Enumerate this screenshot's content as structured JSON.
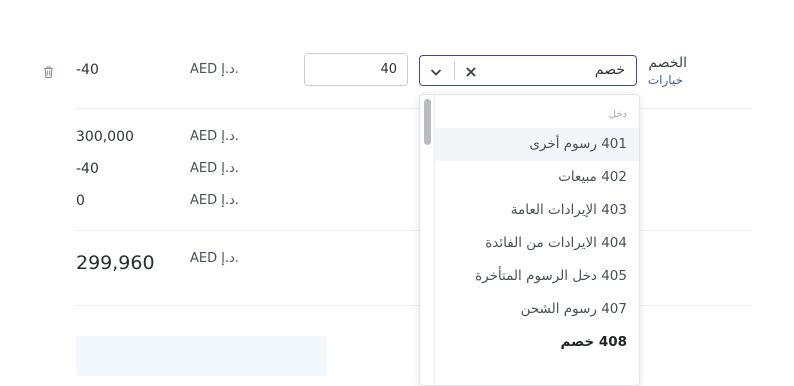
{
  "line_item": {
    "amount": "-40",
    "currency": "AED د.إ.",
    "quantity": "40",
    "account_value": "خصم",
    "label": "الخصم",
    "options_link": "خيارات"
  },
  "dropdown": {
    "group_label": "دخل",
    "options": [
      {
        "label": "401 رسوم أخرى"
      },
      {
        "label": "402 مبيعات"
      },
      {
        "label": "403 الإيرادات العامة"
      },
      {
        "label": "404 الايرادات من الفائدة"
      },
      {
        "label": "405 دخل الرسوم المتأخرة"
      },
      {
        "label": "407 رسوم الشحن"
      },
      {
        "label": "408 خصم"
      }
    ]
  },
  "summary": {
    "rows": [
      {
        "amount": "300,000",
        "currency": "AED د.إ."
      },
      {
        "amount": "-40",
        "currency": "AED د.إ."
      },
      {
        "amount": "0",
        "currency": "AED د.إ."
      }
    ],
    "total": {
      "amount": "299,960",
      "currency": "AED د.إ."
    }
  }
}
